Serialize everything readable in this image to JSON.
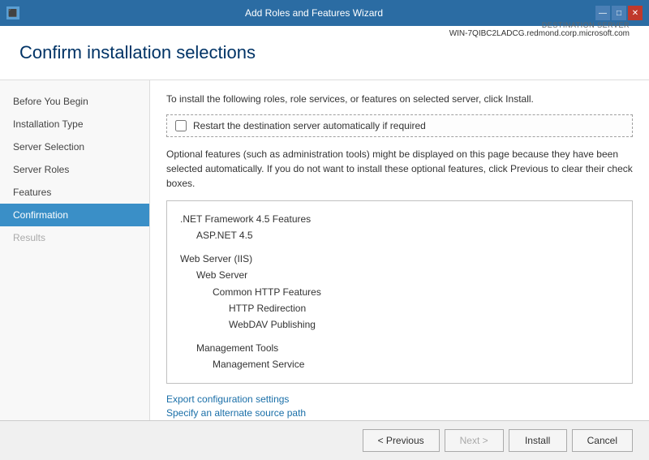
{
  "titlebar": {
    "title": "Add Roles and Features Wizard",
    "icons": {
      "minimize": "—",
      "maximize": "□",
      "close": "✕"
    }
  },
  "header": {
    "title": "Confirm installation selections",
    "destination_label": "DESTINATION SERVER",
    "destination_server": "WIN-7QIBC2LADCG.redmond.corp.microsoft.com"
  },
  "sidebar": {
    "items": [
      {
        "label": "Before You Begin",
        "state": "normal"
      },
      {
        "label": "Installation Type",
        "state": "normal"
      },
      {
        "label": "Server Selection",
        "state": "normal"
      },
      {
        "label": "Server Roles",
        "state": "normal"
      },
      {
        "label": "Features",
        "state": "normal"
      },
      {
        "label": "Confirmation",
        "state": "active"
      },
      {
        "label": "Results",
        "state": "disabled"
      }
    ]
  },
  "content": {
    "intro": "To install the following roles, role services, or features on selected server, click Install.",
    "checkbox_label": "Restart the destination server automatically if required",
    "optional_text": "Optional features (such as administration tools) might be displayed on this page because they have been selected automatically. If you do not want to install these optional features, click Previous to clear their check boxes.",
    "features": [
      {
        "label": ".NET Framework 4.5 Features",
        "indent": 0
      },
      {
        "label": "ASP.NET 4.5",
        "indent": 1
      },
      {
        "label": "",
        "indent": 0
      },
      {
        "label": "Web Server (IIS)",
        "indent": 0
      },
      {
        "label": "Web Server",
        "indent": 1
      },
      {
        "label": "Common HTTP Features",
        "indent": 2
      },
      {
        "label": "HTTP Redirection",
        "indent": 3
      },
      {
        "label": "WebDAV Publishing",
        "indent": 3
      },
      {
        "label": "",
        "indent": 0
      },
      {
        "label": "Management Tools",
        "indent": 1
      },
      {
        "label": "Management Service",
        "indent": 2
      }
    ],
    "links": [
      "Export configuration settings",
      "Specify an alternate source path"
    ]
  },
  "footer": {
    "previous_label": "< Previous",
    "next_label": "Next >",
    "install_label": "Install",
    "cancel_label": "Cancel"
  }
}
